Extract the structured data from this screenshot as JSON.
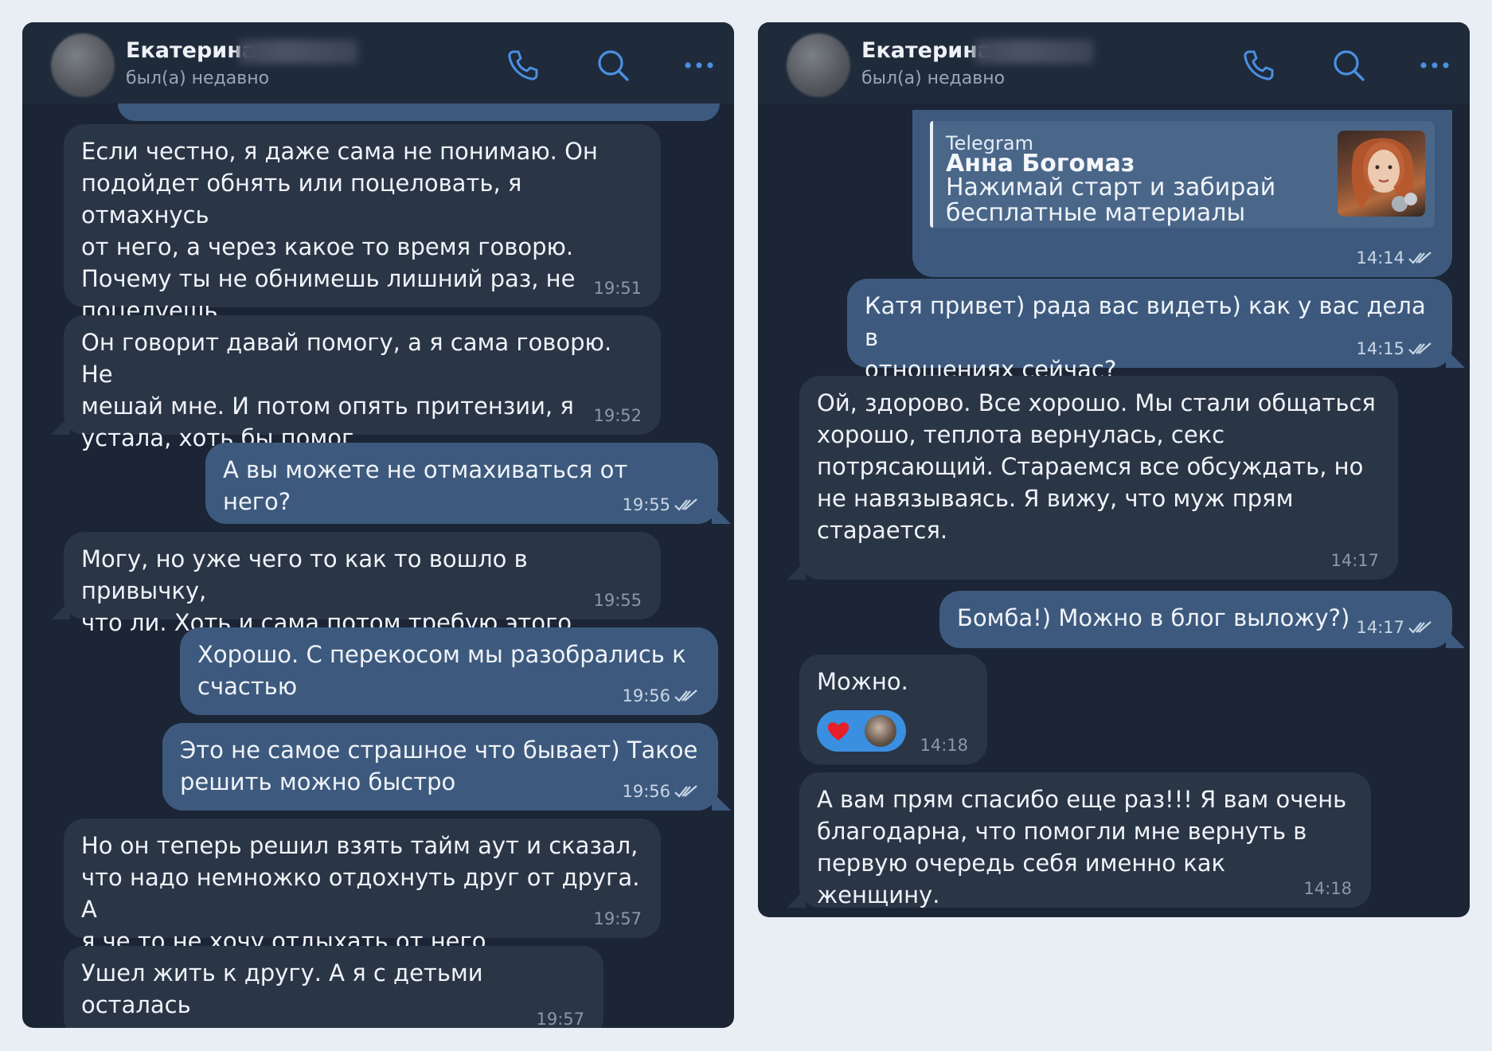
{
  "left": {
    "header": {
      "contact_name": "Екатерина",
      "status": "был(а) недавно",
      "icons": [
        "phone-icon",
        "search-icon",
        "more-icon"
      ]
    },
    "messages": [
      {
        "dir": "in",
        "text": "Если честно, я даже сама не понимаю. Он\nподойдет обнять или поцеловать, я отмахнусь\nот него, а через какое то время говорю.\nПочему ты не обнимешь лишний раз, не\nпоцелуешь.",
        "time": "19:51"
      },
      {
        "dir": "in",
        "text": "Он говорит давай помогу, а я сама говорю. Не\nмешай мне. И потом опять притензии, я\nустала, хоть бы помог",
        "time": "19:52"
      },
      {
        "dir": "out",
        "text": "А вы можете не отмахиваться от него?",
        "time": "19:55",
        "read": true
      },
      {
        "dir": "in",
        "text": "Могу, но уже чего то как то вошло в привычку,\nчто ли. Хоть и сама потом требую этого",
        "time": "19:55"
      },
      {
        "dir": "out",
        "text": "Хорошо. С перекосом мы разобрались к\nсчастью",
        "time": "19:56",
        "read": true
      },
      {
        "dir": "out",
        "text": "Это не самое страшное что бывает) Такое\nрешить можно быстро",
        "time": "19:56",
        "read": true
      },
      {
        "dir": "in",
        "text": "Но он теперь решил взять тайм аут и сказал,\nчто надо немножко отдохнуть друг от друга. А\nя че то не хочу отдыхать от него.",
        "time": "19:57"
      },
      {
        "dir": "in",
        "text": "Ушел жить к другу. А я с детьми осталась\nдома.",
        "time": "19:57"
      }
    ]
  },
  "right": {
    "header": {
      "contact_name": "Екатерина",
      "status": "был(а) недавно",
      "icons": [
        "phone-icon",
        "search-icon",
        "more-icon"
      ]
    },
    "forward": {
      "source": "Telegram",
      "title": "Анна Богомаз",
      "description": "Нажимай старт и забирай\nбесплатные материалы",
      "time": "14:14",
      "read": true
    },
    "messages": [
      {
        "dir": "out",
        "text": "Катя привет) рада вас видеть) как у вас дела в\nотношениях сейчас?",
        "time": "14:15",
        "read": true
      },
      {
        "dir": "in",
        "text": "Ой, здорово. Все хорошо. Мы стали общаться\nхорошо, теплота вернулась, секс\nпотрясающий. Стараемся все обсуждать, но\nне навязываясь. Я вижу, что муж прям\nстарается.",
        "time": "14:17"
      },
      {
        "dir": "out",
        "text": "Бомба!) Можно в блог выложу?)",
        "time": "14:17",
        "read": true
      },
      {
        "dir": "in",
        "text": "Можно.",
        "time": "14:18",
        "reactions": [
          "heart-icon",
          "reaction-avatar"
        ]
      },
      {
        "dir": "in",
        "text": "А вам прям спасибо еще раз!!! Я вам очень\nблагодарна, что помогли мне вернуть в\nпервую очередь себя именно как женщину.",
        "time": "14:18"
      }
    ]
  },
  "colors": {
    "panel_bg": "#1b2535",
    "header_bg": "#1f2a3b",
    "incoming_bubble": "#2a3546",
    "outgoing_bubble": "#3d5a7e",
    "accent": "#4a90e2",
    "page_bg": "#e9edf4"
  }
}
